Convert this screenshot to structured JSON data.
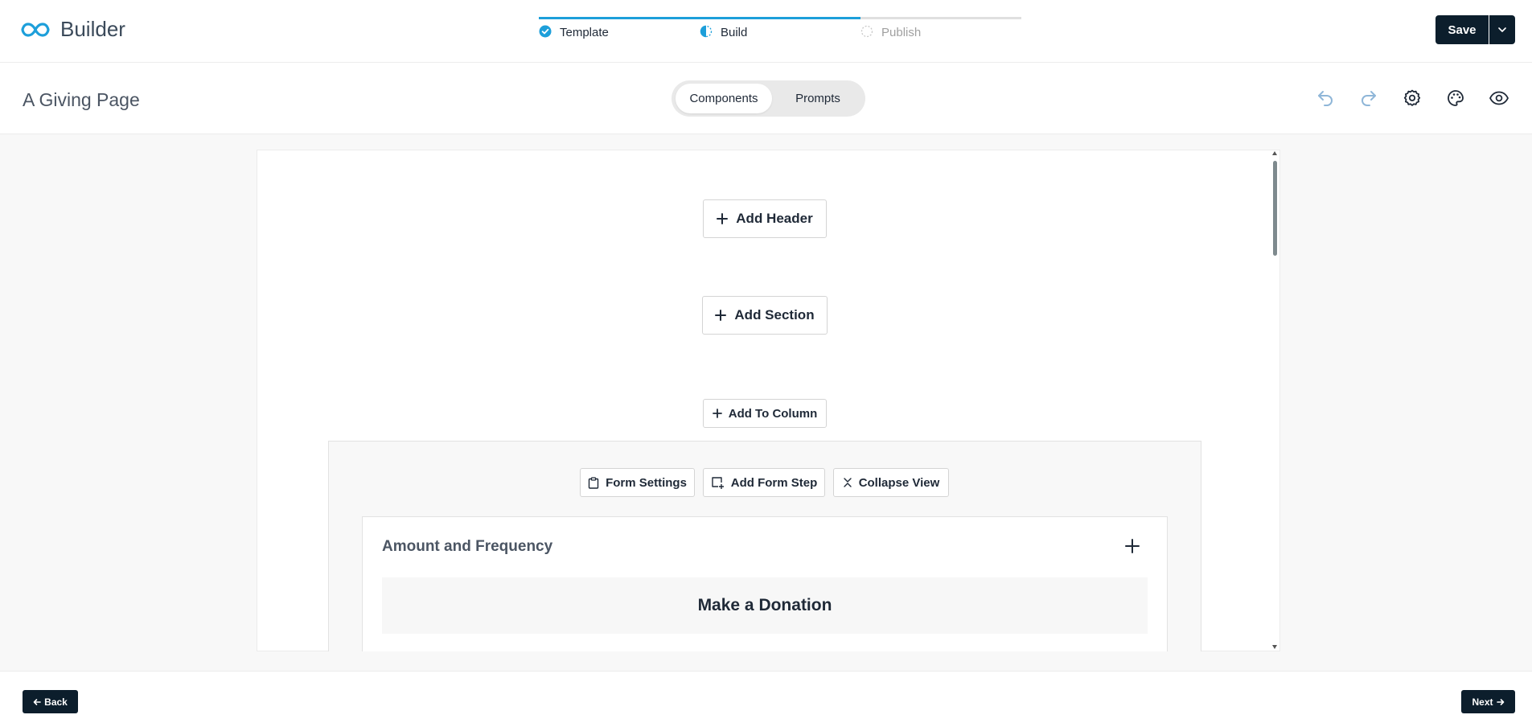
{
  "header": {
    "brand": "Builder",
    "save_label": "Save",
    "steps": [
      {
        "label": "Template",
        "state": "complete"
      },
      {
        "label": "Build",
        "state": "active"
      },
      {
        "label": "Publish",
        "state": "pending"
      }
    ]
  },
  "pagebar": {
    "title": "A Giving Page",
    "tabs": [
      {
        "label": "Components",
        "selected": true
      },
      {
        "label": "Prompts",
        "selected": false
      }
    ],
    "tools": [
      "undo-icon",
      "redo-icon",
      "settings-gear-icon",
      "palette-icon",
      "preview-eye-icon"
    ]
  },
  "canvas": {
    "add_header_label": "Add Header",
    "add_section_label": "Add Section",
    "add_to_column_label": "Add To Column",
    "form": {
      "form_settings_label": "Form Settings",
      "add_form_step_label": "Add Form Step",
      "collapse_view_label": "Collapse View",
      "step_title": "Amount and Frequency",
      "donation_heading": "Make a Donation"
    }
  },
  "footer": {
    "back_label": "Back",
    "next_label": "Next"
  },
  "colors": {
    "primary_dark": "#0c1e2c",
    "accent_blue": "#1d9fda",
    "canvas_bg": "#f8f8f8"
  }
}
